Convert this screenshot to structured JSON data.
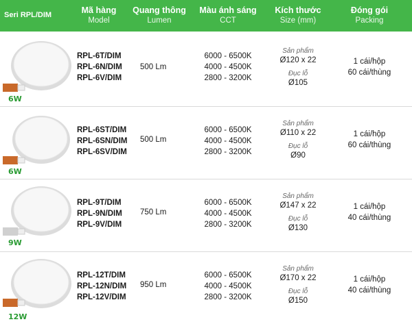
{
  "header": {
    "series": "Seri RPL/DIM",
    "columns": [
      {
        "title": "Mã hàng",
        "sub": "Model"
      },
      {
        "title": "Quang thông",
        "sub": "Lumen"
      },
      {
        "title": "Màu ánh sáng",
        "sub": "CCT"
      },
      {
        "title": "Kích thước",
        "sub": "Size (mm)"
      },
      {
        "title": "Đóng gói",
        "sub": "Packing"
      }
    ]
  },
  "colors": {
    "header_bg": "#44b649",
    "watt_label": "#2a9b33"
  },
  "rows": [
    {
      "watt": "6W",
      "models": [
        "RPL-6T/DIM",
        "RPL-6N/DIM",
        "RPL-6V/DIM"
      ],
      "lumen": "500 Lm",
      "cct": [
        "6000 - 6500K",
        "4000 - 4500K",
        "2800 - 3200K"
      ],
      "product_label": "Sản phẩm",
      "product_size": "Ø120 x 22",
      "hole_label": "Đục lỗ",
      "hole_size": "Ø105",
      "packing": [
        "1 cái/hộp",
        "60 cái/thùng"
      ]
    },
    {
      "watt": "6W",
      "models": [
        "RPL-6ST/DIM",
        "RPL-6SN/DIM",
        "RPL-6SV/DIM"
      ],
      "lumen": "500 Lm",
      "cct": [
        "6000 - 6500K",
        "4000 - 4500K",
        "2800 - 3200K"
      ],
      "product_label": "Sản phẩm",
      "product_size": "Ø110 x 22",
      "hole_label": "Đục lỗ",
      "hole_size": "Ø90",
      "packing": [
        "1 cái/hộp",
        "60 cái/thùng"
      ]
    },
    {
      "watt": "9W",
      "models": [
        "RPL-9T/DIM",
        "RPL-9N/DIM",
        "RPL-9V/DIM"
      ],
      "lumen": "750 Lm",
      "cct": [
        "6000 - 6500K",
        "4000 - 4500K",
        "2800 - 3200K"
      ],
      "product_label": "Sản phẩm",
      "product_size": "Ø147 x 22",
      "hole_label": "Đục lỗ",
      "hole_size": "Ø130",
      "packing": [
        "1 cái/hộp",
        "40 cái/thùng"
      ]
    },
    {
      "watt": "12W",
      "models": [
        "RPL-12T/DIM",
        "RPL-12N/DIM",
        "RPL-12V/DIM"
      ],
      "lumen": "950 Lm",
      "cct": [
        "6000 - 6500K",
        "4000 - 4500K",
        "2800 - 3200K"
      ],
      "product_label": "Sản phẩm",
      "product_size": "Ø170 x 22",
      "hole_label": "Đục lỗ",
      "hole_size": "Ø150",
      "packing": [
        "1 cái/hộp",
        "40 cái/thùng"
      ]
    }
  ]
}
